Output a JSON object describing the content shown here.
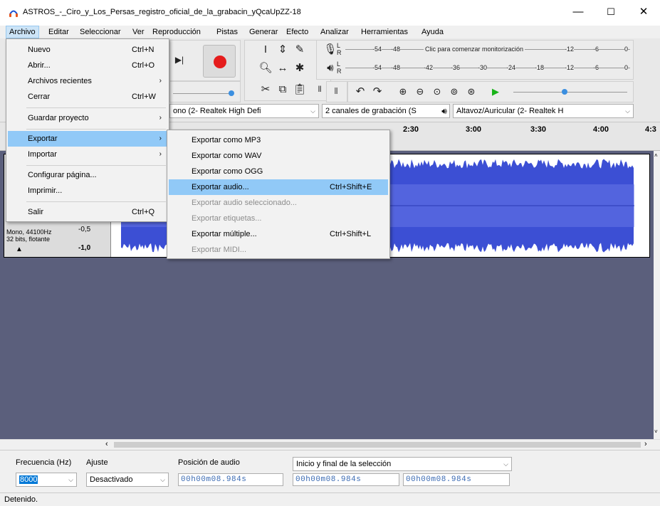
{
  "window": {
    "title": "ASTROS_-_Ciro_y_Los_Persas_registro_oficial_de_la_grabacin_yQcaUpZZ-18",
    "minimize": "—",
    "maximize": "☐",
    "close": "✕"
  },
  "menubar": [
    "Archivo",
    "Editar",
    "Seleccionar",
    "Ver",
    "Reproducción",
    "Pistas",
    "Generar",
    "Efecto",
    "Analizar",
    "Herramientas",
    "Ayuda"
  ],
  "file_menu": {
    "items": [
      {
        "label": "Nuevo",
        "shortcut": "Ctrl+N"
      },
      {
        "label": "Abrir...",
        "shortcut": "Ctrl+O"
      },
      {
        "label": "Archivos recientes",
        "submenu": true
      },
      {
        "label": "Cerrar",
        "shortcut": "Ctrl+W"
      },
      {
        "label": "Guardar proyecto",
        "submenu": true
      },
      {
        "label": "Exportar",
        "submenu": true,
        "highlighted": true
      },
      {
        "label": "Importar",
        "submenu": true
      },
      {
        "label": "Configurar página..."
      },
      {
        "label": "Imprimir..."
      },
      {
        "label": "Salir",
        "shortcut": "Ctrl+Q"
      }
    ]
  },
  "export_menu": {
    "items": [
      {
        "label": "Exportar como MP3"
      },
      {
        "label": "Exportar como WAV"
      },
      {
        "label": "Exportar como OGG"
      },
      {
        "label": "Exportar audio...",
        "shortcut": "Ctrl+Shift+E",
        "highlighted": true
      },
      {
        "label": "Exportar audio seleccionado...",
        "disabled": true
      },
      {
        "label": "Exportar etiquetas...",
        "disabled": true
      },
      {
        "label": "Exportar múltiple...",
        "shortcut": "Ctrl+Shift+L"
      },
      {
        "label": "Exportar MIDI...",
        "disabled": true
      }
    ]
  },
  "meters": {
    "rec_ticks": [
      "-54",
      "-48",
      "Clic para comenzar monitorización",
      "-12",
      "-6",
      "0"
    ],
    "play_ticks": [
      "-54",
      "-48",
      "-42",
      "-36",
      "-30",
      "-24",
      "-18",
      "-12",
      "-6",
      "0"
    ],
    "L": "L",
    "R": "R"
  },
  "devices": {
    "recording": "ono (2- Realtek High Defi",
    "channels": "2 canales de grabación (S",
    "playback": "Altavoz/Auricular (2- Realtek H"
  },
  "timeline": [
    "2:30",
    "3:00",
    "3:30",
    "4:00",
    "4:3"
  ],
  "track": {
    "info": "Mono, 44100Hz",
    "info2": "32 bits, flotante",
    "scale_top": "-0,5",
    "scale_bottom": "-1,0",
    "collapse": "▲"
  },
  "selection_bar": {
    "rate_label": "Frecuencia (Hz)",
    "snap_label": "Ajuste",
    "rate_value": "8000",
    "snap_value": "Desactivado",
    "position_label": "Posición de audio",
    "position_value": "00h00m08.984s",
    "range_label": "Inicio y final de la selección",
    "start_value": "00h00m08.984s",
    "end_value": "00h00m08.984s"
  },
  "status": "Detenido.",
  "colors": {
    "wave": "#3c4fd4",
    "track_bg": "#5b5f7c",
    "highlight": "#91c9f7"
  }
}
